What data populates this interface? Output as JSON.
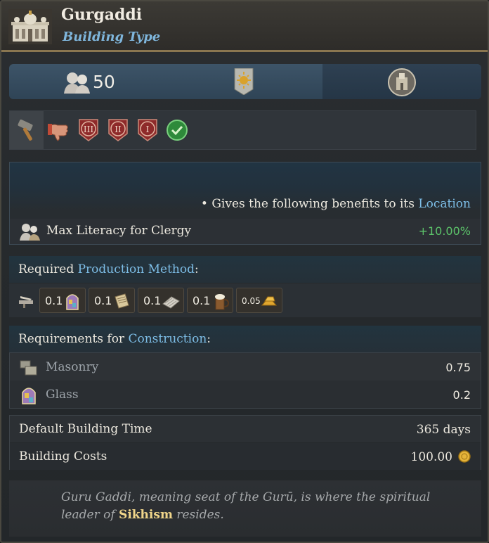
{
  "header": {
    "title": "Gurgaddi",
    "subtitle": "Building Type",
    "icon": "temple-building-icon"
  },
  "stats": {
    "population_value": "50",
    "population_icon": "clergy-pops-icon",
    "rank_icon": "sun-banner-icon",
    "location_icon": "location-globe-icon"
  },
  "tags": [
    {
      "icon": "hammer-icon"
    },
    {
      "icon": "thumbs-down-icon"
    },
    {
      "icon": "shield-rank-icon",
      "label": "III"
    },
    {
      "icon": "shield-rank-icon",
      "label": "II"
    },
    {
      "icon": "shield-rank-icon",
      "label": "I"
    },
    {
      "icon": "green-check-icon"
    }
  ],
  "benefits": {
    "prefix": "• Gives the following benefits to its ",
    "link": "Location",
    "modifier_label": "Max Literacy for Clergy",
    "modifier_value": "+10.00%"
  },
  "production": {
    "heading_prefix": "Required ",
    "heading_link": "Production Method",
    "heading_suffix": ":",
    "goods": [
      {
        "amount": "0.1",
        "icon": "glass-icon"
      },
      {
        "amount": "0.1",
        "icon": "paper-icon"
      },
      {
        "amount": "0.1",
        "icon": "cloth-icon"
      },
      {
        "amount": "0.1",
        "icon": "beer-icon"
      },
      {
        "amount": "0.05",
        "icon": "gold-icon"
      }
    ]
  },
  "construction": {
    "heading_prefix": "Requirements for ",
    "heading_link": "Construction",
    "heading_suffix": ":",
    "items": [
      {
        "label": "Masonry",
        "value": "0.75",
        "icon": "masonry-icon"
      },
      {
        "label": "Glass",
        "value": "0.2",
        "icon": "glass-icon"
      }
    ]
  },
  "info": {
    "time_label": "Default Building Time",
    "time_value": "365 days",
    "cost_label": "Building Costs",
    "cost_value": "100.00",
    "cost_icon": "gold-coin-icon"
  },
  "flavor": {
    "text_1": "Guru Gaddi, meaning seat of the Gurū, is where the spiritual leader of ",
    "highlight": "Sikhism",
    "text_2": " resides."
  },
  "colors": {
    "accent_blue": "#7dbde6",
    "positive_green": "#5cc36a",
    "highlight_gold": "#f0d58a"
  }
}
